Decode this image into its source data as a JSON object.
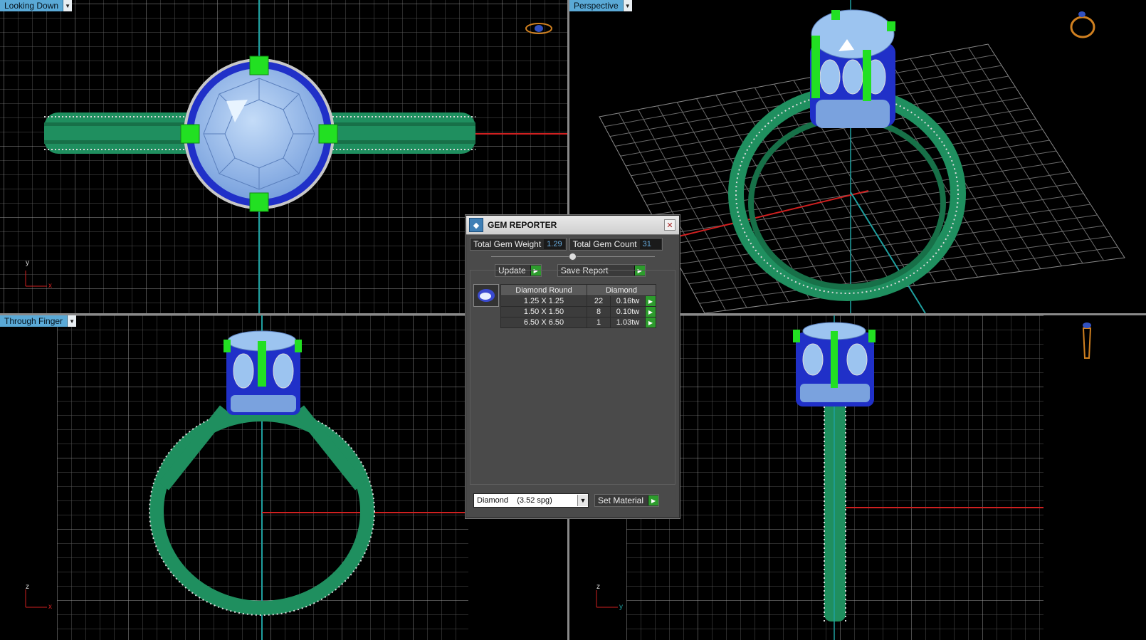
{
  "viewports": {
    "top_left": {
      "label": "Looking Down",
      "axes": [
        "y",
        "x"
      ]
    },
    "top_right": {
      "label": "Perspective"
    },
    "bottom_left": {
      "label": "Through Finger",
      "axes": [
        "z",
        "x"
      ]
    },
    "bottom_right": {
      "axes": [
        "z",
        "y"
      ]
    }
  },
  "gem_reporter": {
    "title": "GEM REPORTER",
    "total_weight_label": "Total Gem Weight",
    "total_weight_value": "1.29",
    "total_count_label": "Total Gem Count",
    "total_count_value": "31",
    "update_label": "Update",
    "save_report_label": "Save Report",
    "table": {
      "headers": [
        "Diamond Round",
        "Diamond"
      ],
      "rows": [
        {
          "size": "1.25 X 1.25",
          "count": "22",
          "weight": "0.16tw"
        },
        {
          "size": "1.50 X 1.50",
          "count": "8",
          "weight": "0.10tw"
        },
        {
          "size": "6.50 X 6.50",
          "count": "1",
          "weight": "1.03tw"
        }
      ]
    },
    "material_select": "Diamond    (3.52 spg)",
    "set_material_label": "Set Material"
  },
  "colors": {
    "ring_metal": "#1f8f5f",
    "gem_blue": "#2030c8",
    "gem_face": "#9cc4f0",
    "prong": "#22e022",
    "grid": "#8a8a8a",
    "axis_red": "#d02020",
    "axis_teal": "#1fa0a0",
    "tab_bg": "#5aa9d6"
  },
  "icons": [
    "ring-preview-icon",
    "close-icon",
    "play-arrow-icon",
    "gem-thumbnail-icon",
    "dropdown-arrow-icon"
  ]
}
